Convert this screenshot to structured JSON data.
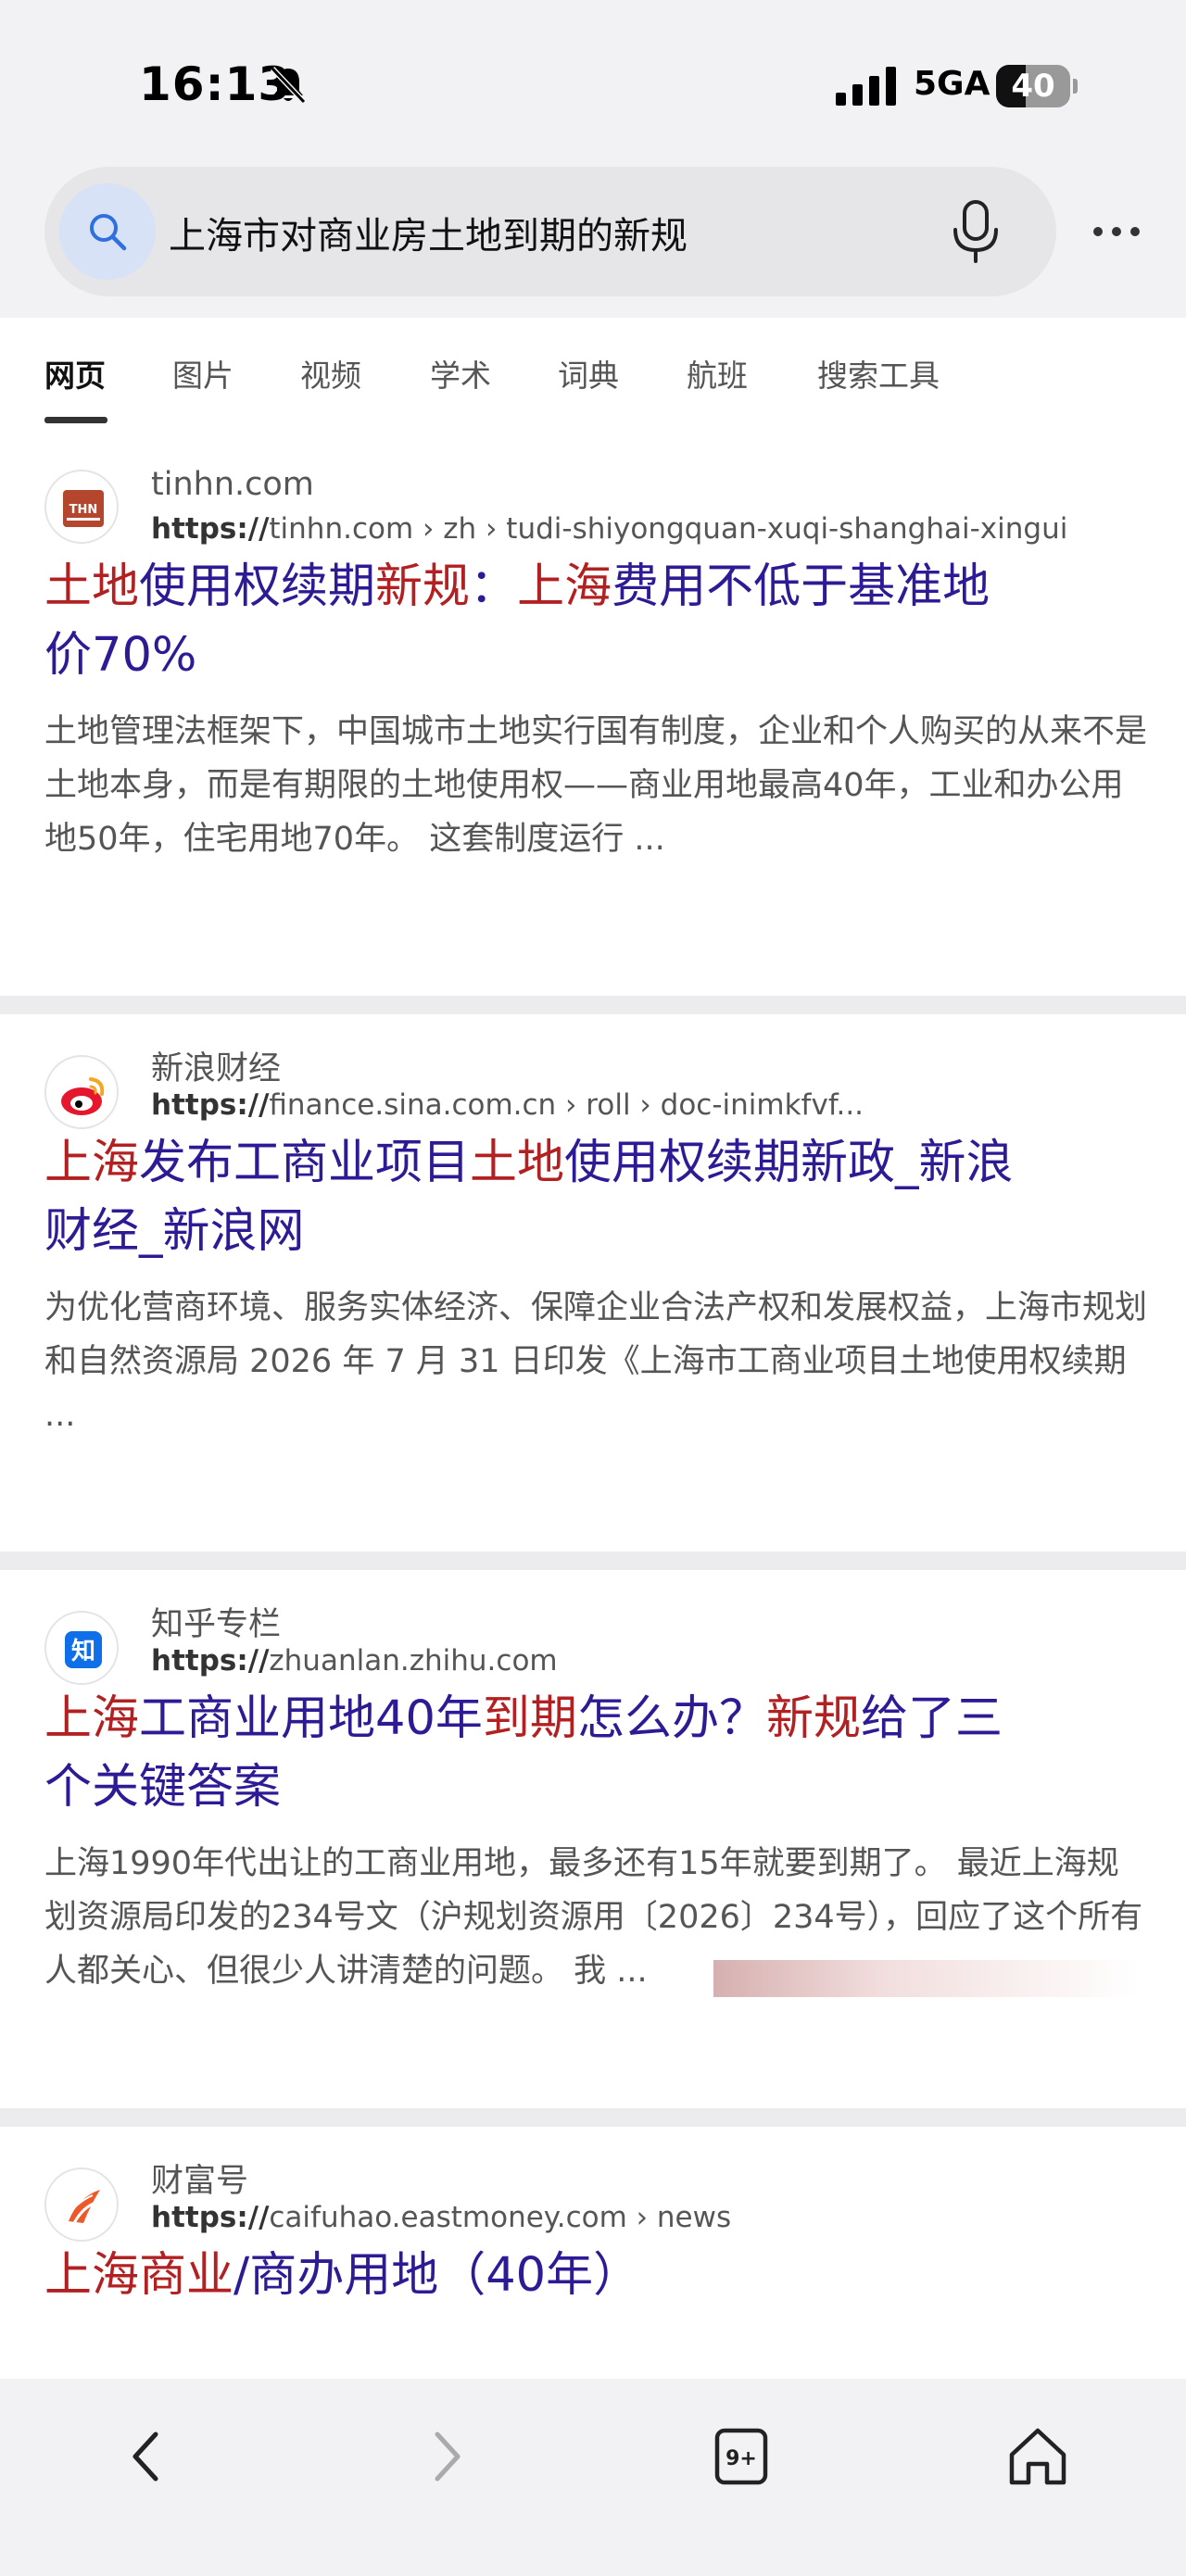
{
  "status": {
    "time": "16:13",
    "network": "5GA",
    "battery": "40"
  },
  "search": {
    "query": "上海市对商业房土地到期的新规"
  },
  "tabs": [
    "网页",
    "图片",
    "视频",
    "学术",
    "词典",
    "航班",
    "搜索工具"
  ],
  "results": [
    {
      "favicon_text": "THN",
      "site": "tinhn.com",
      "url_prefix": "https://",
      "url_rest": "tinhn.com › zh › tudi-shiyongquan-xuqi-shanghai-xingui",
      "title_line1": [
        {
          "t": "土地",
          "hl": true
        },
        {
          "t": "使用权续期",
          "hl": false
        },
        {
          "t": "新规",
          "hl": true
        },
        {
          "t": "：",
          "hl": false
        },
        {
          "t": "上海",
          "hl": true
        },
        {
          "t": "费用不低于基准地",
          "hl": false
        }
      ],
      "title_line2": [
        {
          "t": "价70%",
          "hl": false
        }
      ],
      "snippet": "土地管理法框架下，中国城市土地实行国有制度，企业和个人购买的从来不是土地本身，而是有期限的土地使用权——商业用地最高40年，工业和办公用地50年，住宅用地70年。 这套制度运行 ..."
    },
    {
      "favicon_text": "",
      "site": "新浪财经",
      "url_prefix": "https://",
      "url_rest": "finance.sina.com.cn › roll › doc-inimkfvf...",
      "title_line1": [
        {
          "t": "上海",
          "hl": true
        },
        {
          "t": "发布工商业项目",
          "hl": false
        },
        {
          "t": "土地",
          "hl": true
        },
        {
          "t": "使用权续期新政_新浪",
          "hl": false
        }
      ],
      "title_line2": [
        {
          "t": "财经_新浪网",
          "hl": false
        }
      ],
      "snippet": "为优化营商环境、服务实体经济、保障企业合法产权和发展权益，上海市规划和自然资源局 2026 年 7 月 31 日印发《上海市工商业项目土地使用权续期 ..."
    },
    {
      "favicon_text": "知",
      "site": "知乎专栏",
      "url_prefix": "https://",
      "url_rest": "zhuanlan.zhihu.com",
      "title_line1": [
        {
          "t": "上海",
          "hl": true
        },
        {
          "t": "工商业用地40年",
          "hl": false
        },
        {
          "t": "到期",
          "hl": true
        },
        {
          "t": "怎么办？",
          "hl": false
        },
        {
          "t": "新规",
          "hl": true
        },
        {
          "t": "给了三",
          "hl": false
        }
      ],
      "title_line2": [
        {
          "t": "个关键答案",
          "hl": false
        }
      ],
      "snippet": "上海1990年代出让的工商业用地，最多还有15年就要到期了。 最近上海规划资源局印发的234号文（沪规划资源用〔2026〕234号），回应了这个所有人都关心、但很少人讲清楚的问题。 我 ..."
    },
    {
      "favicon_text": "",
      "site": "财富号",
      "url_prefix": "https://",
      "url_rest": "caifuhao.eastmoney.com › news",
      "title_line1": [
        {
          "t": "上海商业",
          "hl": true
        },
        {
          "t": "/商办用地（40年）",
          "hl": false
        }
      ],
      "title_line2": [],
      "snippet": ""
    }
  ]
}
